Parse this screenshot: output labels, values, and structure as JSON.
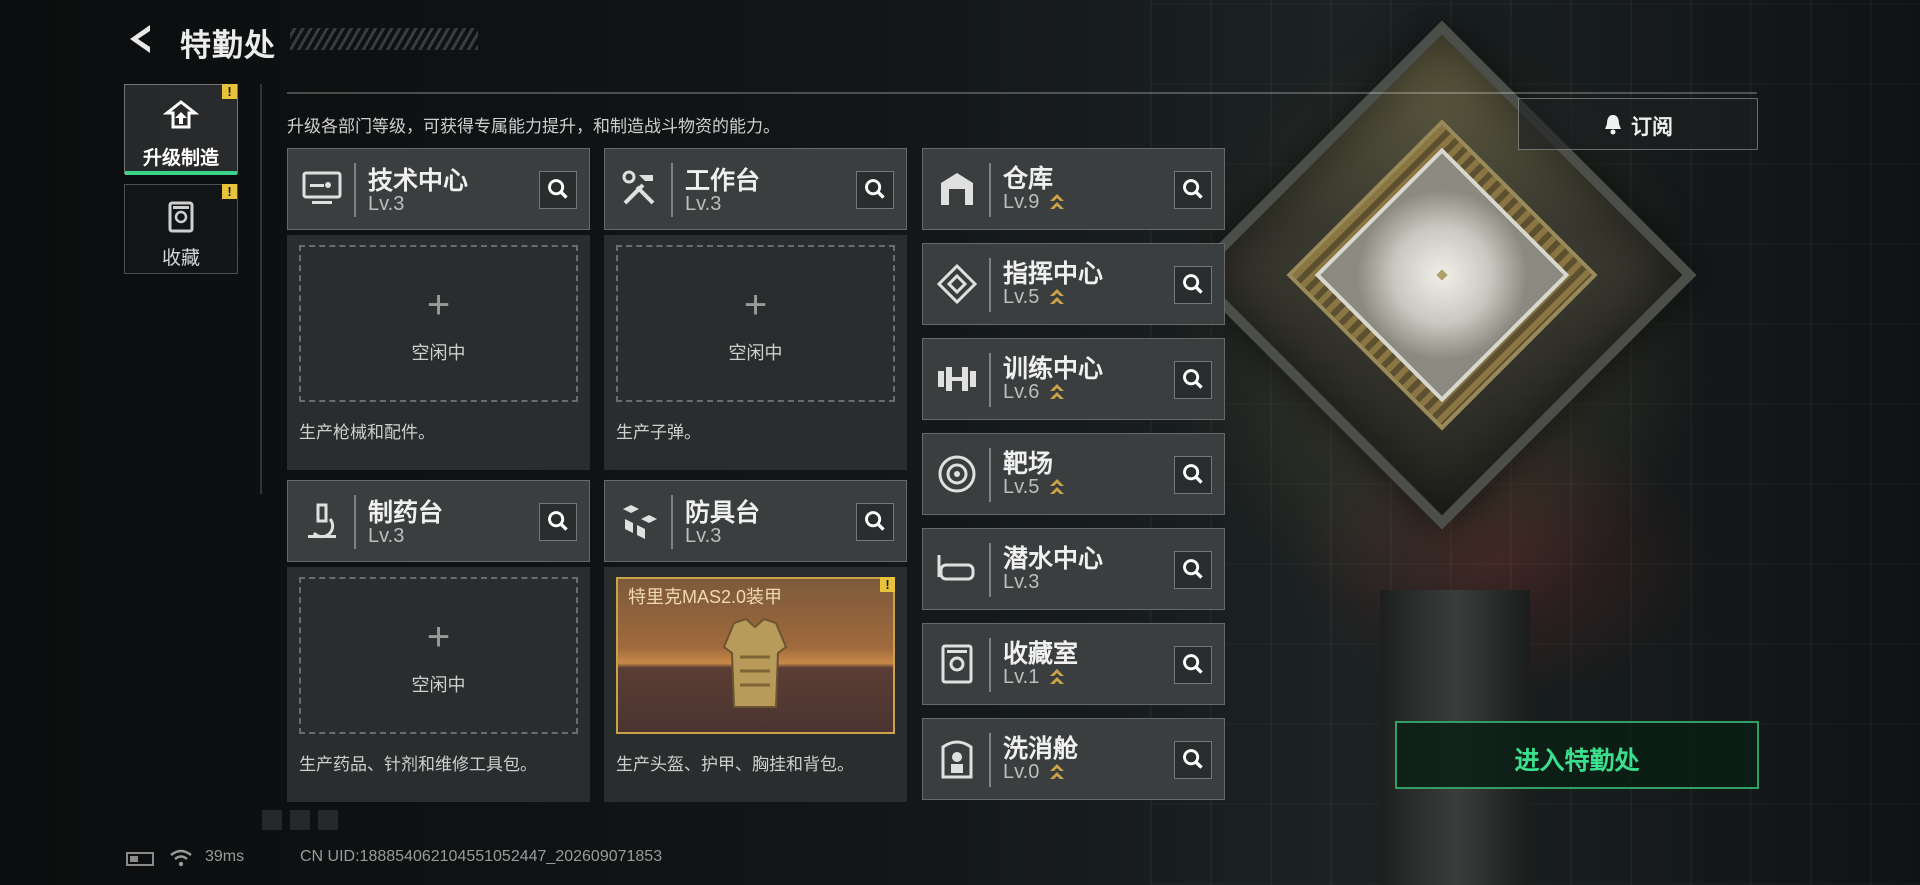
{
  "header": {
    "title": "特勤处",
    "subtitle": "升级各部门等级，可获得专属能力提升，和制造战斗物资的能力。"
  },
  "nav": {
    "items": [
      {
        "label": "升级制造",
        "icon": "upgrade-icon",
        "active": true,
        "alert": "!"
      },
      {
        "label": "收藏",
        "icon": "collection-icon",
        "active": false,
        "alert": "!"
      }
    ]
  },
  "production": [
    {
      "name": "技术中心",
      "level": "Lv.3",
      "slot_label": "空闲中",
      "plus": "+",
      "desc": "生产枪械和配件。",
      "icon": "monitor-icon"
    },
    {
      "name": "工作台",
      "level": "Lv.3",
      "slot_label": "空闲中",
      "plus": "+",
      "desc": "生产子弹。",
      "icon": "tools-icon"
    },
    {
      "name": "制药台",
      "level": "Lv.3",
      "slot_label": "空闲中",
      "plus": "+",
      "desc": "生产药品、针剂和维修工具包。",
      "icon": "microscope-icon"
    },
    {
      "name": "防具台",
      "level": "Lv.3",
      "craft_item": "特里克MAS2.0装甲",
      "craft_alert": "!",
      "desc": "生产头盔、护甲、胸挂和背包。",
      "icon": "armor-blocks-icon"
    }
  ],
  "facilities": [
    {
      "name": "仓库",
      "level": "Lv.9",
      "icon": "warehouse-icon"
    },
    {
      "name": "指挥中心",
      "level": "Lv.5",
      "icon": "command-icon"
    },
    {
      "name": "训练中心",
      "level": "Lv.6",
      "icon": "dumbbell-icon"
    },
    {
      "name": "靶场",
      "level": "Lv.5",
      "icon": "target-icon"
    },
    {
      "name": "潜水中心",
      "level": "Lv.3",
      "icon": "diving-mask-icon"
    },
    {
      "name": "收藏室",
      "level": "Lv.1",
      "icon": "collection-room-icon"
    },
    {
      "name": "洗消舱",
      "level": "Lv.0",
      "icon": "decon-icon"
    }
  ],
  "buttons": {
    "subscribe": "订阅",
    "enter": "进入特勤处"
  },
  "status": {
    "ping": "39ms",
    "uid": "CN UID:18885406210455105244​7_202609071853"
  },
  "colors": {
    "accent_green": "#3be08f",
    "alert_yellow": "#e8c23a",
    "upgrade_gold": "#c9a24a"
  }
}
